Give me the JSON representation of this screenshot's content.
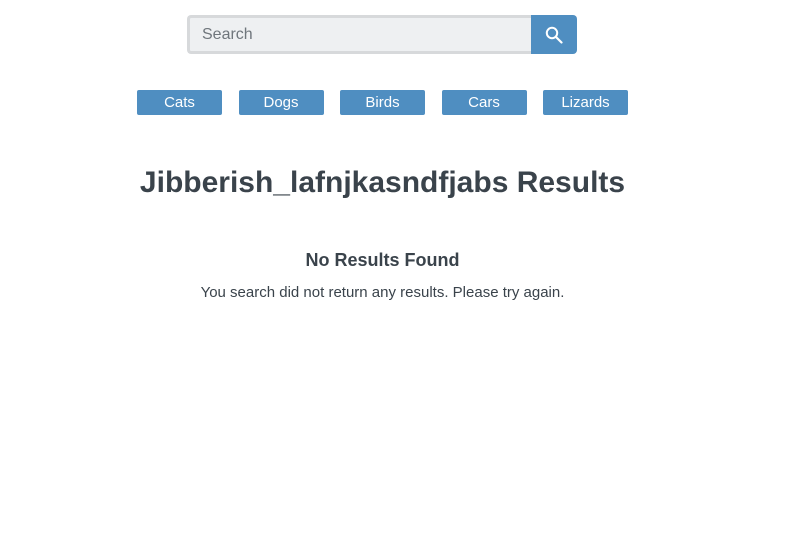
{
  "search": {
    "placeholder": "Search",
    "value": "",
    "button_icon": "search-icon"
  },
  "categories": [
    {
      "label": "Cats"
    },
    {
      "label": "Dogs"
    },
    {
      "label": "Birds"
    },
    {
      "label": "Cars"
    },
    {
      "label": "Lizards"
    }
  ],
  "results": {
    "title": "Jibberish_lafnjkasndfjabs Results",
    "empty_heading": "No Results Found",
    "empty_message": "You search did not return any results. Please try again."
  },
  "colors": {
    "accent": "#4f8ec1",
    "text": "#3a434b",
    "input_bg": "#eef0f2",
    "input_border": "#d7d9db"
  }
}
